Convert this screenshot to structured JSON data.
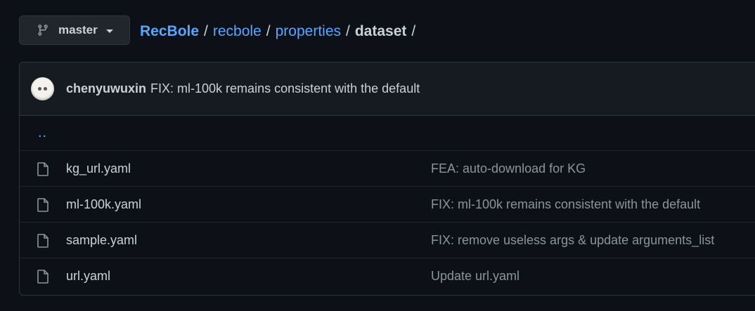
{
  "branch": {
    "name": "master",
    "icon": "git-branch-icon"
  },
  "breadcrumb": {
    "root": "RecBole",
    "parts": [
      "recbole",
      "properties"
    ],
    "current": "dataset",
    "separator": "/"
  },
  "latest_commit": {
    "author": "chenyuwuxin",
    "message": "FIX: ml-100k remains consistent with the default"
  },
  "parent_dir": "..",
  "files": [
    {
      "name": "kg_url.yaml",
      "commit": "FEA: auto-download for KG",
      "icon": "file-icon"
    },
    {
      "name": "ml-100k.yaml",
      "commit": "FIX: ml-100k remains consistent with the default",
      "icon": "file-icon"
    },
    {
      "name": "sample.yaml",
      "commit": "FIX: remove useless args & update arguments_list",
      "icon": "file-icon"
    },
    {
      "name": "url.yaml",
      "commit": "Update url.yaml",
      "icon": "file-icon"
    }
  ],
  "colors": {
    "background": "#0d1117",
    "link": "#58a6ff",
    "muted": "#8b949e",
    "border": "#30363d"
  }
}
